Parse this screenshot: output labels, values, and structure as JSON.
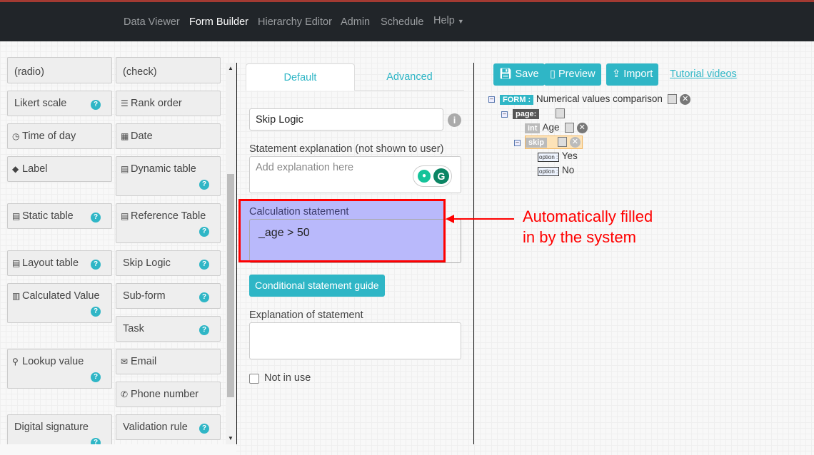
{
  "nav": {
    "items": [
      "Data Viewer",
      "Form Builder",
      "Hierarchy Editor",
      "Admin",
      "Schedule",
      "Help"
    ],
    "active": "Form Builder"
  },
  "palette": {
    "radio": "(radio)",
    "check": "(check)",
    "likert": "Likert scale",
    "rank": "Rank order",
    "time": "Time of day",
    "date": "Date",
    "label": "Label",
    "dynamic": "Dynamic table",
    "static": "Static table",
    "reference": "Reference Table",
    "layout": "Layout table",
    "skip": "Skip Logic",
    "calculated": "Calculated Value",
    "subform": "Sub-form",
    "task": "Task",
    "lookup": "Lookup value",
    "email": "Email",
    "phone": "Phone number",
    "signature": "Digital signature",
    "validation": "Validation rule",
    "help": "?"
  },
  "editor": {
    "tabs": [
      "Default",
      "Advanced"
    ],
    "name_value": "Skip Logic",
    "explanation_label": "Statement explanation (not shown to user)",
    "explanation_placeholder": "Add explanation here",
    "calc_label": "Calculation statement",
    "calc_value": "_age > 50",
    "guide_button": "Conditional statement guide",
    "stmt_expl_label": "Explanation of statement",
    "not_in_use": "Not in use"
  },
  "annotation": {
    "line1": "Automatically filled",
    "line2": "in by the system",
    "color": "#ff0000"
  },
  "toolbar": {
    "save": "Save",
    "preview": "Preview",
    "import": "Import",
    "tutorial": "Tutorial videos"
  },
  "tree": {
    "form_tag": "FORM :",
    "form_name": "Numerical values comparison",
    "page_tag": "page:",
    "int_tag": "int",
    "int_name": "Age",
    "skip_tag": "skip",
    "option_tag": "option :",
    "options": [
      "Yes",
      "No"
    ]
  },
  "colors": {
    "accent": "#2fb6c6",
    "navbar": "#212529",
    "highlight": "#b9b9fb"
  }
}
